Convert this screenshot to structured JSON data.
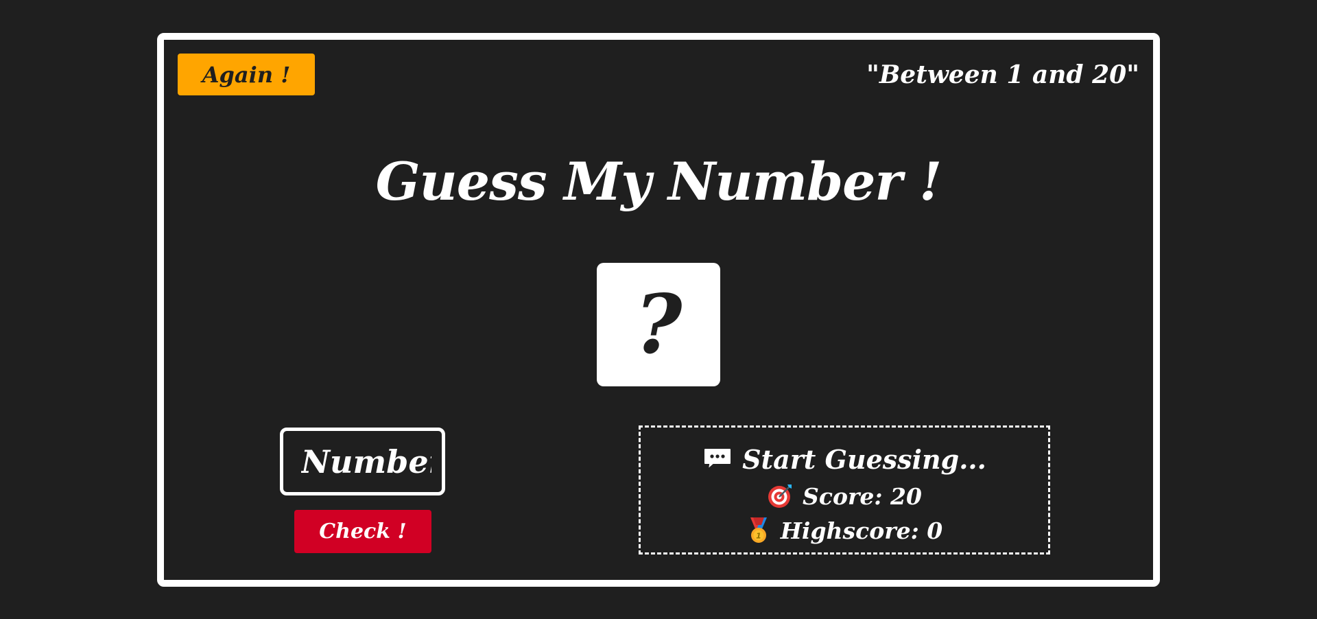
{
  "game": {
    "again_label": "Again !",
    "range_text": "\"Between 1 and 20\"",
    "title": "Guess My Number !",
    "secret_placeholder": "?",
    "input_placeholder": "Number",
    "check_label": "Check !",
    "message": "Start Guessing...",
    "score_label": "Score: 20",
    "highscore_label": "Highscore: 0",
    "score": 20,
    "highscore": 0,
    "range_min": 1,
    "range_max": 20
  },
  "icons": {
    "message": "speech-bubble-icon",
    "score": "target-icon",
    "highscore": "medal-icon"
  },
  "colors": {
    "background": "#1f1f1f",
    "foreground": "#ffffff",
    "again_button": "#ffa500",
    "check_button": "#d10024"
  }
}
